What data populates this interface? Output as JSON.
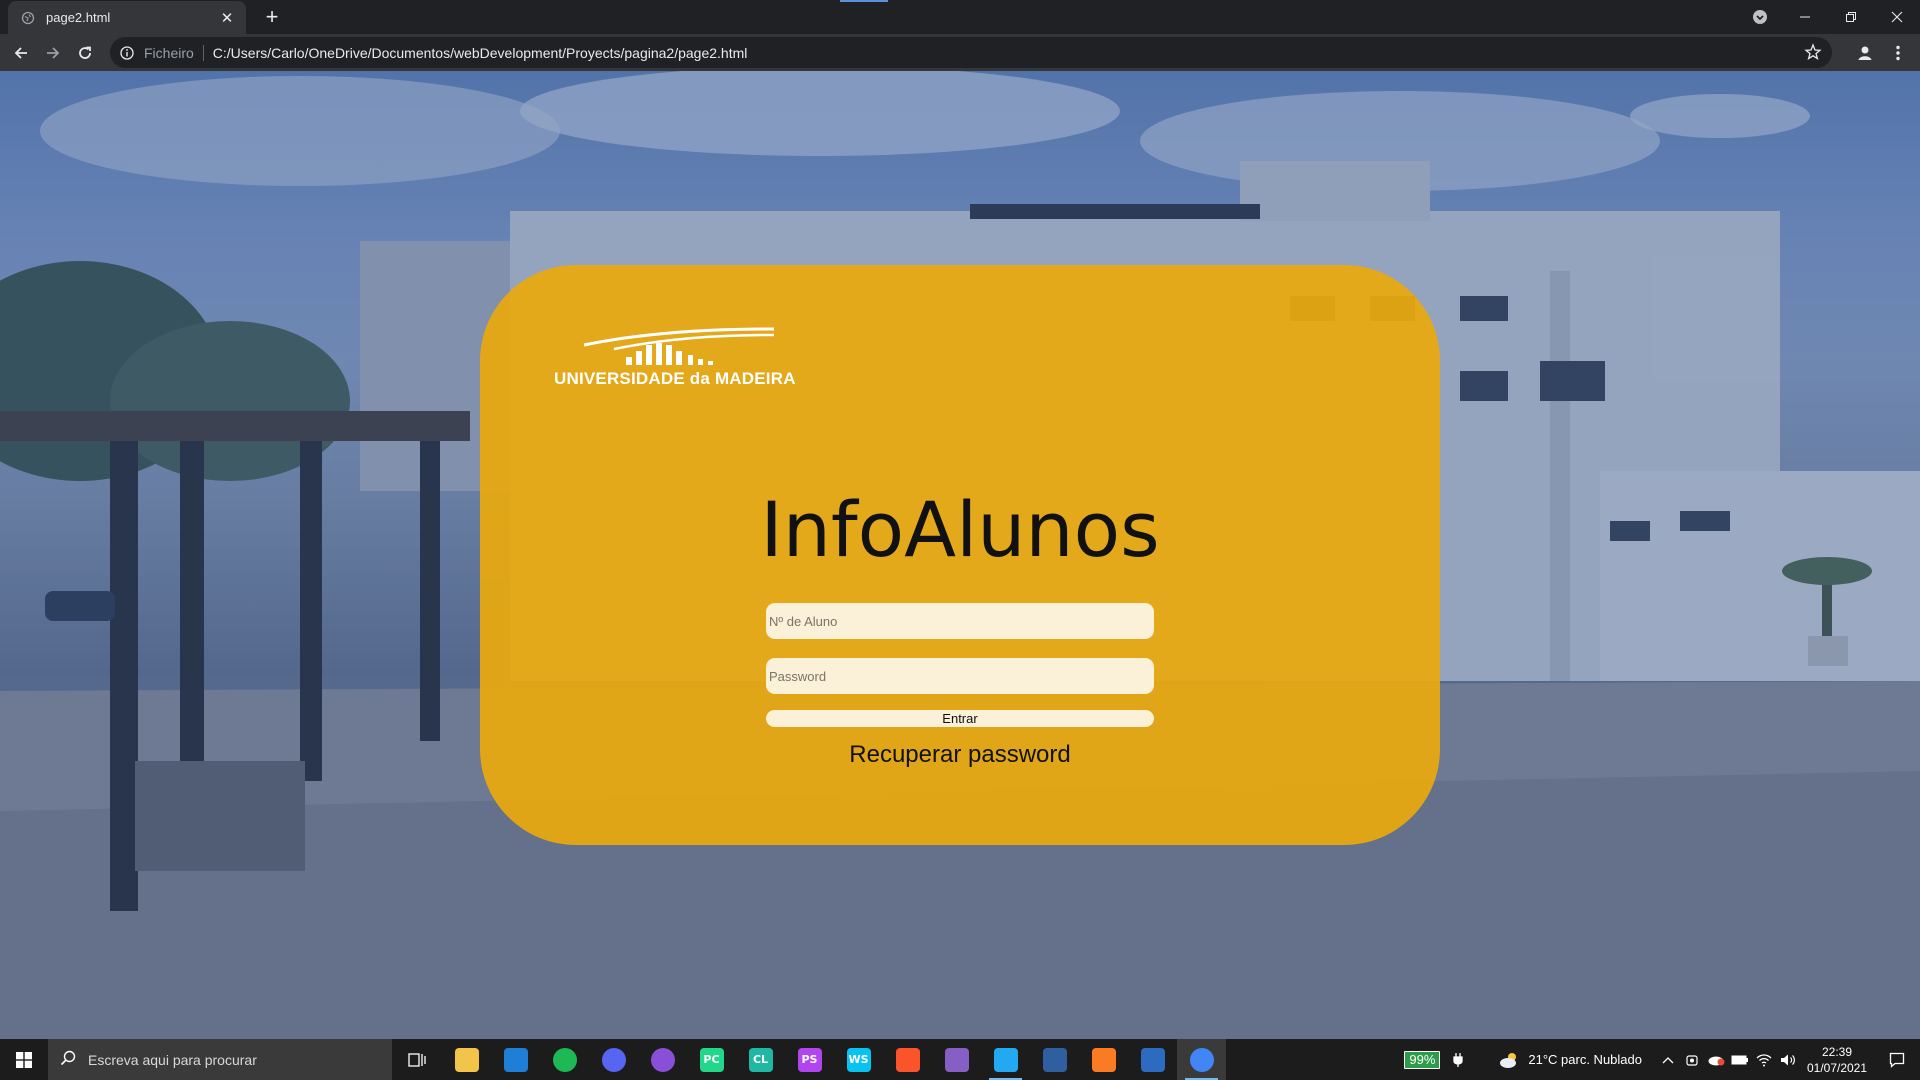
{
  "browser": {
    "tab_title": "page2.html",
    "scheme_label": "Ficheiro",
    "url": "C:/Users/Carlo/OneDrive/Documentos/webDevelopment/Proyects/pagina2/page2.html"
  },
  "page": {
    "logo_text": "UNIVERSIDADE da MADEIRA",
    "title": "InfoAlunos",
    "student_number_placeholder": "Nº de Aluno",
    "password_placeholder": "Password",
    "submit_label": "Entrar",
    "recover_label": "Recuperar password",
    "card_color": "#eaa90e"
  },
  "taskbar": {
    "search_placeholder": "Escreva aqui para procurar",
    "pinned_apps": [
      {
        "name": "file-explorer",
        "glyph": "",
        "color": "#f3c44a"
      },
      {
        "name": "mail",
        "glyph": "",
        "color": "#1f7ed6"
      },
      {
        "name": "spotify",
        "glyph": "",
        "color": "#1db954"
      },
      {
        "name": "discord",
        "glyph": "",
        "color": "#5865f2"
      },
      {
        "name": "github-desktop",
        "glyph": "",
        "color": "#8a4fd8"
      },
      {
        "name": "pycharm",
        "glyph": "PC",
        "color": "#21d789"
      },
      {
        "name": "clion",
        "glyph": "CL",
        "color": "#1fb8a4"
      },
      {
        "name": "phpstorm",
        "glyph": "PS",
        "color": "#b345f1"
      },
      {
        "name": "webstorm",
        "glyph": "WS",
        "color": "#07c3f2"
      },
      {
        "name": "brave",
        "glyph": "",
        "color": "#fb542b"
      },
      {
        "name": "visual-studio",
        "glyph": "",
        "color": "#865fc5"
      },
      {
        "name": "vscode",
        "glyph": "",
        "color": "#23a9f2"
      },
      {
        "name": "network-app",
        "glyph": "",
        "color": "#2f5f9e"
      },
      {
        "name": "xampp",
        "glyph": "",
        "color": "#fb7a24"
      },
      {
        "name": "powershell",
        "glyph": "",
        "color": "#2d6bc0"
      },
      {
        "name": "chrome",
        "glyph": "",
        "color": "#4285f4"
      }
    ],
    "battery": "99%",
    "weather": "21°C  parc. Nublado",
    "time": "22:39",
    "date": "01/07/2021"
  }
}
